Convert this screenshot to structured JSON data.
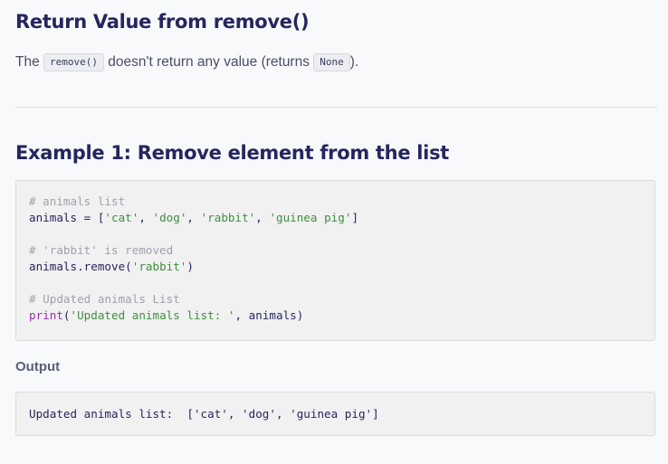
{
  "section1": {
    "heading": "Return Value from remove()",
    "text_before": "The ",
    "code": "remove()",
    "text_middle": " doesn't return any value (returns ",
    "code2": "None",
    "text_after": ")."
  },
  "section2": {
    "heading": "Example 1: Remove element from the list",
    "code": {
      "line1_comment": "# animals list",
      "line2_prefix": "animals = [",
      "line2_s1": "'cat'",
      "sep": ", ",
      "line2_s2": "'dog'",
      "line2_s3": "'rabbit'",
      "line2_s4": "'guinea pig'",
      "line2_suffix": "]",
      "line4_comment": "# 'rabbit' is removed",
      "line5_prefix": "animals.remove(",
      "line5_str": "'rabbit'",
      "line5_suffix": ")",
      "line7_comment": "# Updated animals List",
      "line8_kw": "print",
      "line8_open": "(",
      "line8_str": "'Updated animals list: '",
      "line8_rest": ", animals)"
    },
    "output_label": "Output",
    "output_text": "Updated animals list:  ['cat', 'dog', 'guinea pig']"
  },
  "colors": {
    "heading": "#25265e",
    "comment": "#a0a2ab",
    "string": "#3e8f3e",
    "keyword": "#9b2fae",
    "code_bg": "#f1f1f2"
  }
}
